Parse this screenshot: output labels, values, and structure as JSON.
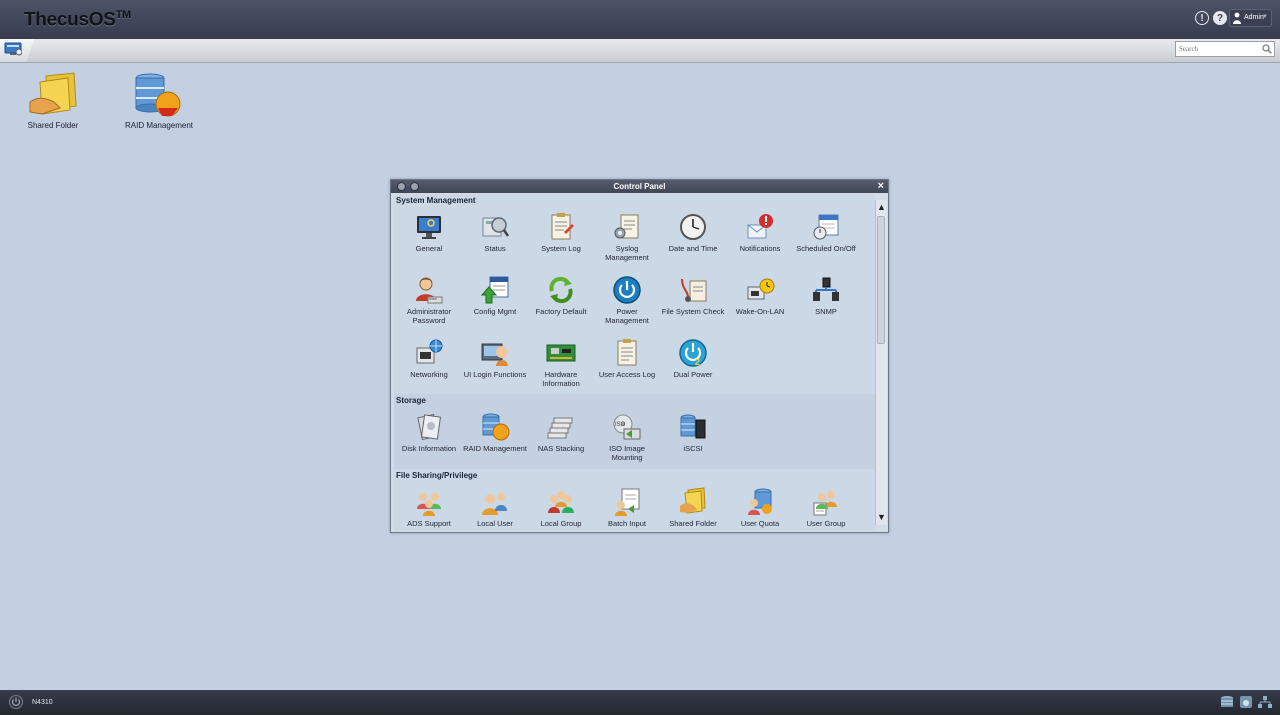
{
  "header": {
    "brand": "ThecusOS",
    "brand_sup": "TM",
    "alert_glyph": "!",
    "help_glyph": "?",
    "user_name": "Admin",
    "user_caret": "▼"
  },
  "tabstrip": {
    "search_placeholder": "Search"
  },
  "desktop": {
    "shortcuts": [
      {
        "label": "Shared Folder",
        "icon": "shared-folder-icon"
      },
      {
        "label": "RAID Management",
        "icon": "raid-management-icon"
      }
    ]
  },
  "control_panel": {
    "title": "Control Panel",
    "close_glyph": "×",
    "scroll_up": "▲",
    "scroll_down": "▼",
    "sections": [
      {
        "title": "System Management",
        "items": [
          {
            "label": "General",
            "icon": "general-monitor-icon"
          },
          {
            "label": "Status",
            "icon": "status-icon"
          },
          {
            "label": "System Log",
            "icon": "system-log-icon"
          },
          {
            "label": "Syslog Management",
            "icon": "syslog-management-icon"
          },
          {
            "label": "Date and Time",
            "icon": "clock-icon"
          },
          {
            "label": "Notifications",
            "icon": "notifications-icon"
          },
          {
            "label": "Scheduled On/Off",
            "icon": "scheduled-onoff-icon"
          },
          {
            "label": "Administrator Password",
            "icon": "admin-password-icon"
          },
          {
            "label": "Config Mgmt",
            "icon": "config-mgmt-icon"
          },
          {
            "label": "Factory Default",
            "icon": "factory-default-icon"
          },
          {
            "label": "Power Management",
            "icon": "power-management-icon"
          },
          {
            "label": "File System Check",
            "icon": "file-system-check-icon"
          },
          {
            "label": "Wake-On-LAN",
            "icon": "wake-on-lan-icon"
          },
          {
            "label": "SNMP",
            "icon": "snmp-icon"
          },
          {
            "label": "Networking",
            "icon": "networking-icon"
          },
          {
            "label": "UI Login Functions",
            "icon": "ui-login-icon"
          },
          {
            "label": "Hardware Information",
            "icon": "hardware-info-icon"
          },
          {
            "label": "User Access Log",
            "icon": "user-access-log-icon"
          },
          {
            "label": "Dual Power",
            "icon": "dual-power-icon"
          }
        ]
      },
      {
        "title": "Storage",
        "items": [
          {
            "label": "Disk Information",
            "icon": "disk-information-icon"
          },
          {
            "label": "RAID Management",
            "icon": "raid-management-icon"
          },
          {
            "label": "NAS Stacking",
            "icon": "nas-stacking-icon"
          },
          {
            "label": "ISO Image Mounting",
            "icon": "iso-mount-icon"
          },
          {
            "label": "iSCSI",
            "icon": "iscsi-icon"
          }
        ]
      },
      {
        "title": "File Sharing/Privilege",
        "items": [
          {
            "label": "ADS Support",
            "icon": "ads-support-icon"
          },
          {
            "label": "Local User",
            "icon": "local-user-icon"
          },
          {
            "label": "Local Group",
            "icon": "local-group-icon"
          },
          {
            "label": "Batch Input",
            "icon": "batch-input-icon"
          },
          {
            "label": "Shared Folder",
            "icon": "shared-folder-icon"
          },
          {
            "label": "User Quota",
            "icon": "user-quota-icon"
          },
          {
            "label": "User Group",
            "icon": "user-group-icon"
          }
        ]
      }
    ]
  },
  "taskbar": {
    "model": "N4310"
  }
}
